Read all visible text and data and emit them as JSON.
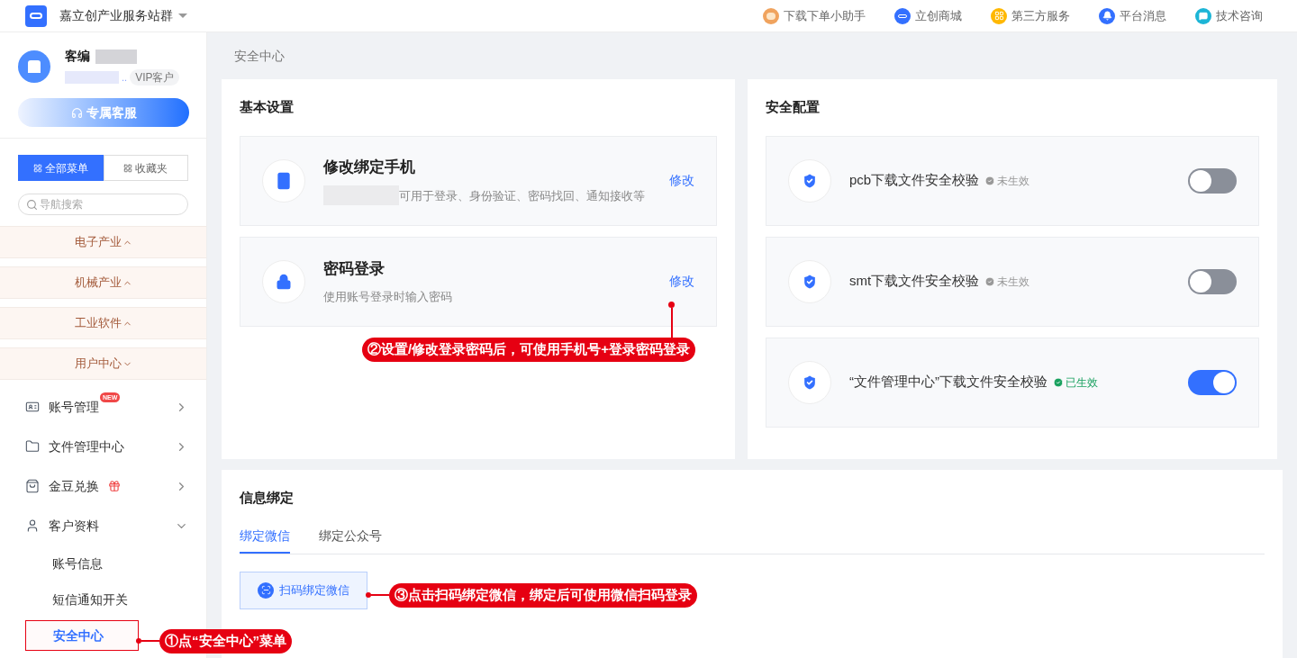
{
  "header": {
    "site_title": "嘉立创产业服务站群",
    "links": [
      {
        "kind": "avatar",
        "label": "下载下单小助手"
      },
      {
        "kind": "mall",
        "label": "立创商城"
      },
      {
        "kind": "grid",
        "label": "第三方服务"
      },
      {
        "kind": "bell",
        "label": "平台消息"
      },
      {
        "kind": "chat",
        "label": "技术咨询"
      }
    ]
  },
  "sidebar": {
    "user": {
      "name_prefix": "客编",
      "ellipsis": "..",
      "badge": "VIP客户"
    },
    "service_button": "专属客服",
    "menu_tabs": [
      {
        "label": "全部菜单",
        "selected": true
      },
      {
        "label": "收藏夹",
        "selected": false
      }
    ],
    "search": {
      "placeholder": "导航搜索"
    },
    "sections": [
      {
        "label": "电子产业",
        "expanded": false
      },
      {
        "label": "机械产业",
        "expanded": false
      },
      {
        "label": "工业软件",
        "expanded": false
      },
      {
        "label": "用户中心",
        "expanded": true
      }
    ],
    "items": [
      {
        "kind": "card",
        "label": "账号管理",
        "badge": "NEW",
        "expanded": false
      },
      {
        "kind": "folder",
        "label": "文件管理中心",
        "expanded": false
      },
      {
        "kind": "bag",
        "label": "金豆兑换",
        "gift": true,
        "expanded": false
      },
      {
        "kind": "user",
        "label": "客户资料",
        "expanded": true,
        "children": [
          {
            "label": "账号信息",
            "selected": false
          },
          {
            "label": "短信通知开关",
            "selected": false
          },
          {
            "label": "安全中心",
            "selected": true
          }
        ]
      }
    ]
  },
  "breadcrumb": "安全中心",
  "basic": {
    "title": "基本设置",
    "rows": [
      {
        "kind": "phone",
        "title": "修改绑定手机",
        "masked": true,
        "desc": "可用于登录、身份验证、密码找回、通知接收等",
        "action": "修改"
      },
      {
        "kind": "lock",
        "title": "密码登录",
        "masked": false,
        "desc": "使用账号登录时输入密码",
        "action": "修改"
      }
    ]
  },
  "security": {
    "title": "安全配置",
    "rows": [
      {
        "label": "pcb下载文件安全校验",
        "status": "未生效",
        "on": false
      },
      {
        "label": "smt下载文件安全校验",
        "status": "未生效",
        "on": false
      },
      {
        "label": "“文件管理中心”下载文件安全校验",
        "status": "已生效",
        "on": true
      }
    ]
  },
  "binding": {
    "title": "信息绑定",
    "tabs": [
      {
        "label": "绑定微信",
        "selected": true
      },
      {
        "label": "绑定公众号",
        "selected": false
      }
    ],
    "scan_button": "扫码绑定微信"
  },
  "callouts": [
    "①点“安全中心”菜单",
    "②设置/修改登录密码后，可使用手机号+登录密码登录",
    "③点击扫码绑定微信，绑定后可使用微信扫码登录"
  ]
}
